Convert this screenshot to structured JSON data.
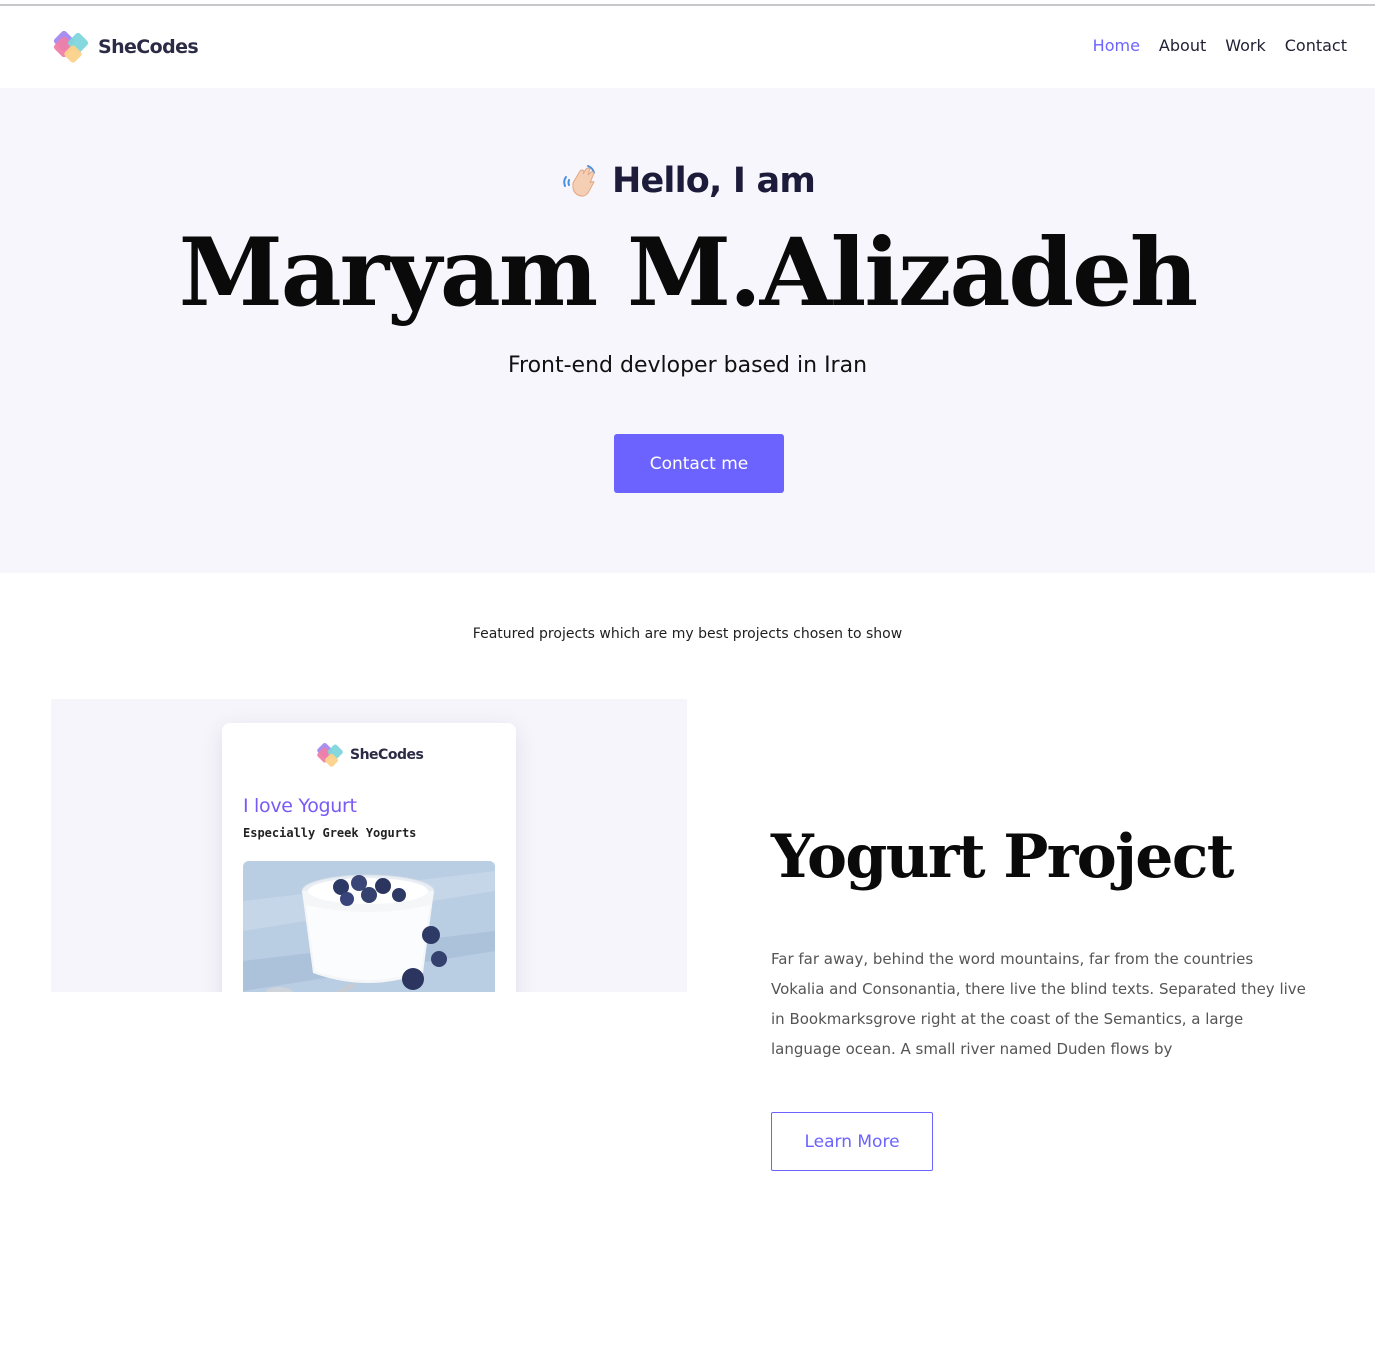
{
  "brand": {
    "name": "SheCodes",
    "colors": {
      "accent": "#6c63ff",
      "hero_bg": "#f7f6fc",
      "heading": "#0a0a0a",
      "body_text": "#555555",
      "mock_title": "#7a5af5"
    }
  },
  "nav": {
    "items": [
      {
        "label": "Home",
        "active": true
      },
      {
        "label": "About",
        "active": false
      },
      {
        "label": "Work",
        "active": false
      },
      {
        "label": "Contact",
        "active": false
      }
    ]
  },
  "hero": {
    "greeting_icon": "waving-hand-icon",
    "greeting": "Hello, I am",
    "name": "Maryam M.Alizadeh",
    "subtitle": "Front-end devloper based in Iran",
    "cta_label": "Contact me"
  },
  "projects": {
    "intro": "Featured projects which are my best projects chosen to show",
    "items": [
      {
        "preview": {
          "brand": "SheCodes",
          "title": "I love Yogurt",
          "subtitle": "Especially Greek Yogurts",
          "photo": "yogurt-with-blueberries-image"
        },
        "title": "Yogurt Project",
        "description": "Far far away, behind the word mountains, far from the countries Vokalia and Consonantia, there live the blind texts. Separated they live in Bookmarksgrove right at the coast of the Semantics, a large language ocean. A small river named Duden flows by",
        "button_label": "Learn More"
      }
    ]
  }
}
